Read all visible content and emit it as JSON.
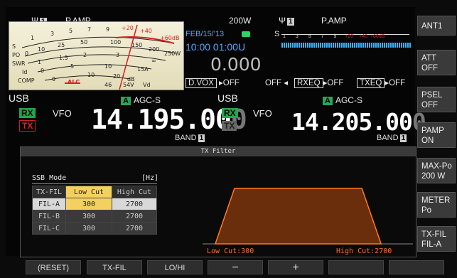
{
  "top": {
    "left_ant": "1",
    "left_pamp": "P.AMP",
    "power": "200W",
    "right_ant": "1",
    "right_pamp": "P.AMP"
  },
  "meter": {
    "rows": {
      "s": "S",
      "po": "PO",
      "swr": "SWR",
      "id": "Id",
      "comp": "COMP"
    },
    "s_scale": [
      "1",
      "3",
      "5",
      "7",
      "9",
      "+20",
      "+40",
      "+60dB"
    ],
    "po_scale": [
      "0",
      "10",
      "25",
      "50",
      "100",
      "150",
      "200",
      "250W"
    ],
    "swr_scale": [
      "1",
      "1.5",
      "2",
      "3",
      "∞"
    ],
    "id_scale": [
      "0",
      "5",
      "10",
      "15A"
    ],
    "comp_scale": [
      "0",
      "10",
      "20",
      "dB"
    ],
    "alc_label": "ALC",
    "vd_scale": [
      "46",
      "54V",
      "Vd"
    ]
  },
  "clock": {
    "date": "FEB/15/'13",
    "time": "10:00 01:00U"
  },
  "rit": "0.000",
  "sub_s": {
    "label": "S",
    "scale": [
      "1",
      "3",
      "5",
      "7",
      "9",
      "+20",
      "+40",
      "+60dB"
    ]
  },
  "toggles": {
    "dvox": "D.VOX",
    "dvox_state": "OFF",
    "nb_state": "OFF",
    "rxeq": "RXEQ",
    "rxeq_state": "OFF",
    "txeq": "TXEQ",
    "txeq_state": "OFF"
  },
  "main": {
    "mode": "USB",
    "rx": "RX",
    "tx": "TX",
    "vfo": "VFO",
    "agc_tag": "A",
    "agc": "AGC-S",
    "freq_main": "14.195.00",
    "freq_last": "0",
    "band_label": "BAND",
    "band_num": "1"
  },
  "sub": {
    "mode": "USB",
    "rx": "RX",
    "tx": "TX",
    "vfo": "VFO",
    "agc_tag": "A",
    "agc": "AGC-S",
    "freq_main": "14.205.00",
    "freq_last": "0",
    "band_label": "BAND",
    "band_num": "1"
  },
  "right_buttons": [
    {
      "line1": "ANT1",
      "line2": ""
    },
    {
      "line1": "ATT",
      "line2": "OFF"
    },
    {
      "line1": "PSEL",
      "line2": "OFF"
    },
    {
      "line1": "PAMP",
      "line2": "ON"
    },
    {
      "line1": "MAX-Po",
      "line2": "200 W"
    },
    {
      "line1": "METER",
      "line2": "Po"
    },
    {
      "line1": "TX-FIL",
      "line2": "FIL-A"
    }
  ],
  "filter": {
    "title": "TX Filter",
    "mode": "SSB Mode",
    "unit": "[Hz]",
    "headers": [
      "TX-FIL",
      "Low Cut",
      "High Cut"
    ],
    "rows": [
      [
        "FIL-A",
        "300",
        "2700"
      ],
      [
        "FIL-B",
        "300",
        "2700"
      ],
      [
        "FIL-C",
        "300",
        "2700"
      ]
    ],
    "low_cut_label": "Low Cut:300",
    "high_cut_label": "High Cut:2700",
    "low_cut_hz": 300,
    "high_cut_hz": 2700
  },
  "bottom": [
    "(RESET)",
    "TX-FIL",
    "LO/HI",
    "−",
    "+",
    "",
    ""
  ],
  "colors": {
    "accent_blue": "#4fa9ff",
    "rx_green": "#23a64a",
    "tx_red": "#d22222",
    "filter_orange": "#ff7a20",
    "filter_fill": "#6a2e0c",
    "highlight_yellow": "#f4d060"
  }
}
